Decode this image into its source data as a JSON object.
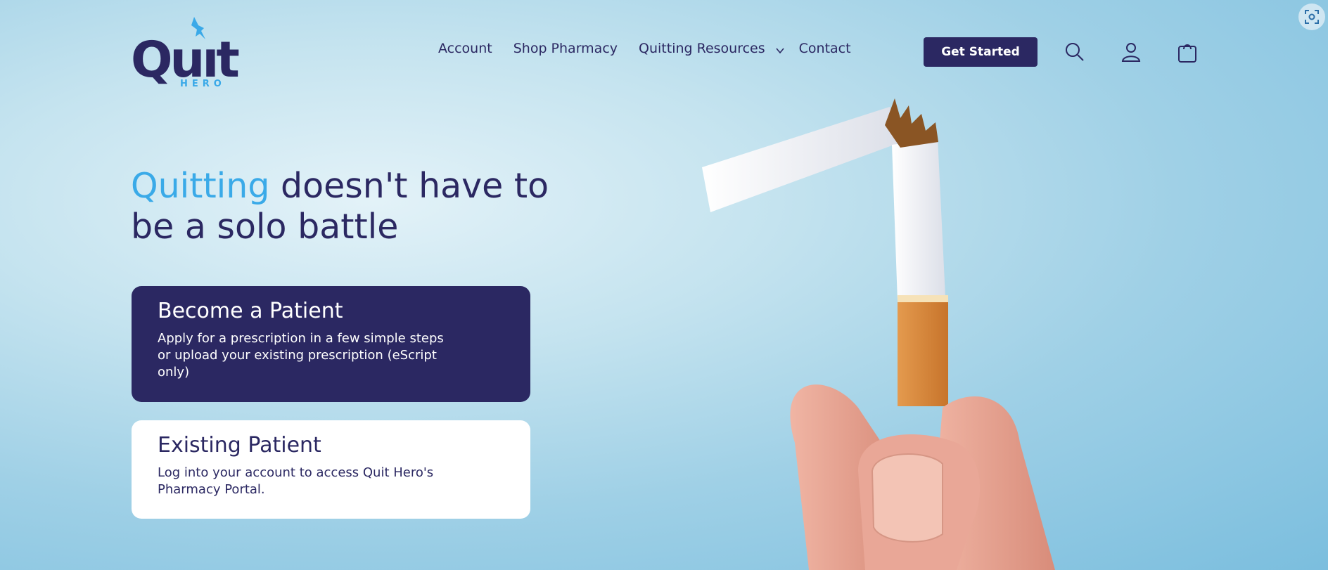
{
  "brand": {
    "logo_word": "Quıt",
    "logo_sub": "HERO"
  },
  "nav": {
    "items": [
      "Account",
      "Shop Pharmacy",
      "Quitting Resources",
      "Contact"
    ]
  },
  "header": {
    "cta_label": "Get Started"
  },
  "hero": {
    "headline_accent": "Quitting",
    "headline_rest": " doesn't have to be a solo battle"
  },
  "cards": [
    {
      "title": "Become a Patient",
      "text": "Apply for a prescription in a few simple steps or upload your existing prescription (eScript only)"
    },
    {
      "title": "Existing Patient",
      "text": "Log into your account to access Quit Hero's Pharmacy Portal."
    }
  ],
  "colors": {
    "brand_navy": "#2b2862",
    "brand_blue": "#3aaae8"
  },
  "icons": [
    "search-icon",
    "account-icon",
    "cart-icon",
    "chevron-down-icon",
    "screenshot-icon"
  ]
}
